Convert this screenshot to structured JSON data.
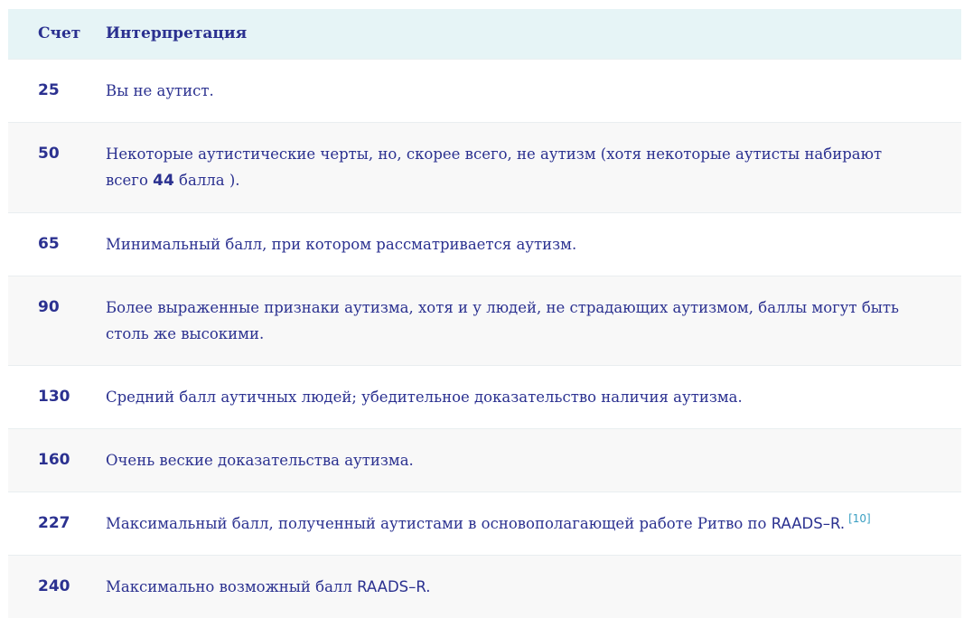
{
  "table": {
    "headers": {
      "score": "Счет",
      "interpretation": "Интерпретация"
    },
    "rows": [
      {
        "score": "25",
        "text": "Вы не аутист."
      },
      {
        "score": "50",
        "text_before": "Некоторые аутистические черты, но, скорее всего, не аутизм (хотя некоторые аутисты набирают всего ",
        "text_number": "44",
        "text_after": " балла )."
      },
      {
        "score": "65",
        "text": "Минимальный балл, при котором рассматривается аутизм."
      },
      {
        "score": "90",
        "text": "Более выраженные признаки аутизма, хотя и у людей, не страдающих аутизмом, баллы могут быть столь же высокими."
      },
      {
        "score": "130",
        "text": "Средний балл аутичных людей; убедительное доказательство наличия аутизма."
      },
      {
        "score": "160",
        "text": "Очень веские доказательства аутизма."
      },
      {
        "score": "227",
        "text": "Максимальный балл, полученный аутистами в основополагающей работе Ритво по ",
        "text_sans": "RAADS–R.",
        "ref": "[10]"
      },
      {
        "score": "240",
        "text": "Максимально возможный балл ",
        "text_sans": "RAADS–R."
      }
    ]
  },
  "colors": {
    "text": "#2b3190",
    "header_bg": "#e6f4f6",
    "alt_row_bg": "#f8f8f8",
    "ref_link": "#3a9fc2"
  }
}
